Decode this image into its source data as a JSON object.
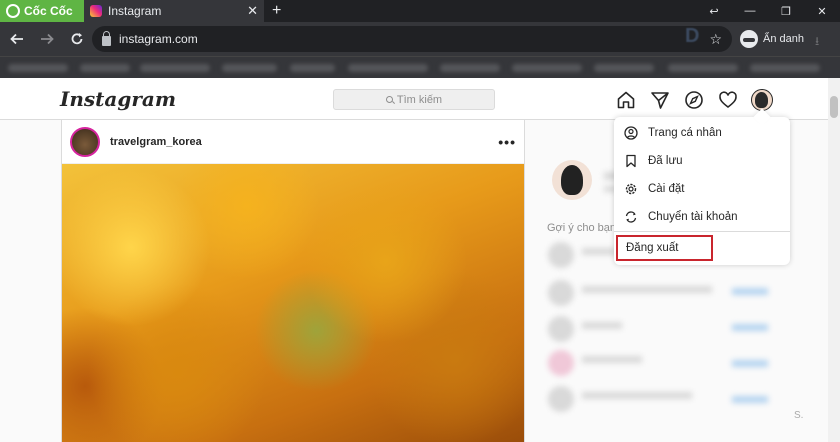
{
  "browser": {
    "brand": "Cốc Cốc",
    "tab_title": "Instagram",
    "tab_close": "✕",
    "new_tab": "+",
    "url": "instagram.com",
    "incognito_label": "Ẩn danh",
    "window_controls": [
      "↩",
      "—",
      "❐",
      "✕"
    ]
  },
  "instagram": {
    "logo": "Instagram",
    "search_placeholder": "Tìm kiếm"
  },
  "post": {
    "username": "travelgram_korea",
    "more": "•••"
  },
  "sidebar": {
    "suggestions_title": "Gợi ý cho bạn",
    "footer_fragment": "S."
  },
  "menu": {
    "items": [
      {
        "label": "Trang cá nhân",
        "icon": "profile-icon"
      },
      {
        "label": "Đã lưu",
        "icon": "bookmark-icon"
      },
      {
        "label": "Cài đặt",
        "icon": "settings-icon"
      },
      {
        "label": "Chuyển tài khoản",
        "icon": "switch-account-icon"
      }
    ],
    "logout": "Đăng xuất"
  },
  "colors": {
    "browser_brand": "#5fb544",
    "highlight_border": "#c9252d"
  }
}
